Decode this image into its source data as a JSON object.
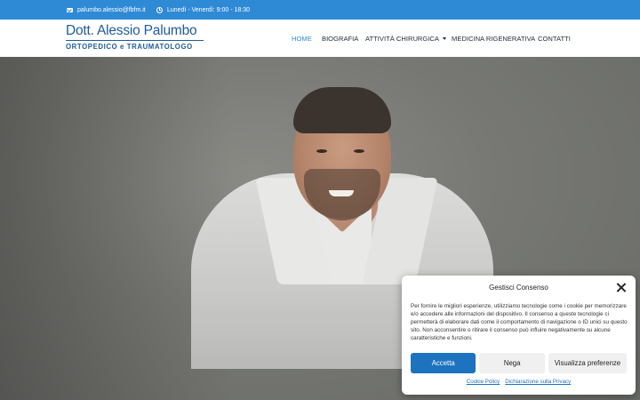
{
  "topbar": {
    "email": "palumbo.alessio@fbfm.it",
    "hours": "Lunedì - Venerdì: 9:00 - 18:30",
    "email_icon": "envelope-icon",
    "hours_icon": "clock-icon",
    "background": "#2f8ad6"
  },
  "logo": {
    "name": "Dott. Alessio Palumbo",
    "subtitle": "ORTOPEDICO e TRAUMATOLOGO",
    "color": "#1f5c99"
  },
  "nav": {
    "items": [
      {
        "label": "HOME",
        "active": true
      },
      {
        "label": "BIOGRAFIA",
        "active": false
      },
      {
        "label": "ATTIVITÀ CHIRURGICA",
        "active": false,
        "has_dropdown": true
      },
      {
        "label": "MEDICINA RIGENERATIVA",
        "active": false
      },
      {
        "label": "CONTATTI",
        "active": false
      }
    ],
    "active_color": "#2f8ad6"
  },
  "cookie_banner": {
    "title": "Gestisci Consenso",
    "text": "Per fornire le migliori esperienze, utilizziamo tecnologie come i cookie per memorizzare e/o accedere alle informazioni del dispositivo. Il consenso a queste tecnologie ci permetterà di elaborare dati come il comportamento di navigazione o ID unici su questo sito. Non acconsentire o ritirare il consenso può influire negativamente su alcune caratteristiche e funzioni.",
    "accept_label": "Accetta",
    "deny_label": "Nega",
    "preferences_label": "Visualizza preferenze",
    "cookie_policy_link": "Cookie Policy",
    "privacy_link": "Dichiarazione sulla Privacy",
    "accent": "#1e73be"
  }
}
